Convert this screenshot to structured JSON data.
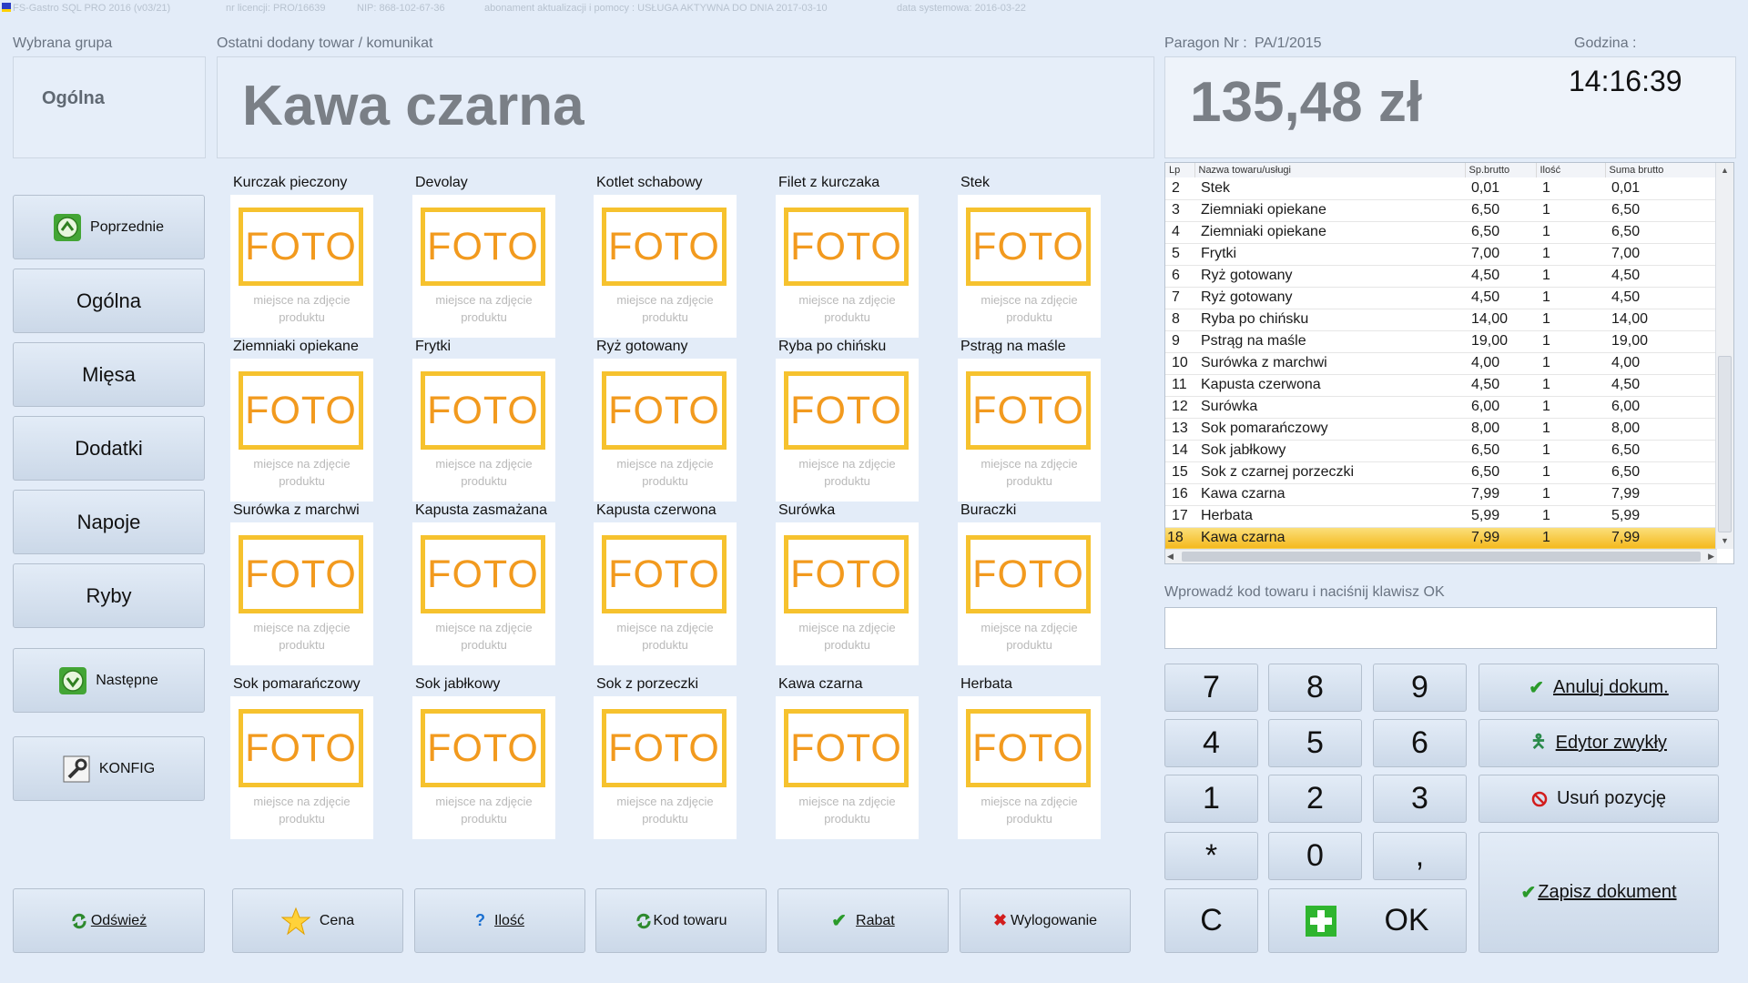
{
  "titlebar": {
    "app": "FS-Gastro SQL PRO 2016 (v03/21)",
    "license": "nr licencji: PRO/16639",
    "nip": "NIP: 868-102-67-36",
    "subscription": "abonament aktualizacji i pomocy : USŁUGA AKTYWNA DO DNIA 2017-03-10",
    "sysdate": "data systemowa: 2016-03-22"
  },
  "group": {
    "label": "Wybrana grupa",
    "value": "Ogólna"
  },
  "last": {
    "label": "Ostatni dodany towar / komunikat",
    "value": "Kawa czarna"
  },
  "receipt": {
    "label": "Paragon Nr :",
    "number": "PA/1/2015",
    "total": "135,48 zł",
    "time_label": "Godzina :",
    "time": "14:16:39"
  },
  "table": {
    "headers": [
      "Lp",
      "Nazwa towaru/usługi",
      "Sp.brutto",
      "Ilość",
      "Suma brutto"
    ],
    "rows": [
      [
        "2",
        "Stek",
        "0,01",
        "1",
        "0,01"
      ],
      [
        "3",
        "Ziemniaki opiekane",
        "6,50",
        "1",
        "6,50"
      ],
      [
        "4",
        "Ziemniaki opiekane",
        "6,50",
        "1",
        "6,50"
      ],
      [
        "5",
        "Frytki",
        "7,00",
        "1",
        "7,00"
      ],
      [
        "6",
        "Ryż gotowany",
        "4,50",
        "1",
        "4,50"
      ],
      [
        "7",
        "Ryż gotowany",
        "4,50",
        "1",
        "4,50"
      ],
      [
        "8",
        "Ryba po chińsku",
        "14,00",
        "1",
        "14,00"
      ],
      [
        "9",
        "Pstrąg na maśle",
        "19,00",
        "1",
        "19,00"
      ],
      [
        "10",
        "Surówka z marchwi",
        "4,00",
        "1",
        "4,00"
      ],
      [
        "11",
        "Kapusta czerwona",
        "4,50",
        "1",
        "4,50"
      ],
      [
        "12",
        "Surówka",
        "6,00",
        "1",
        "6,00"
      ],
      [
        "13",
        "Sok pomarańczowy",
        "8,00",
        "1",
        "8,00"
      ],
      [
        "14",
        "Sok jabłkowy",
        "6,50",
        "1",
        "6,50"
      ],
      [
        "15",
        "Sok z czarnej porzeczki",
        "6,50",
        "1",
        "6,50"
      ],
      [
        "16",
        "Kawa czarna",
        "7,99",
        "1",
        "7,99"
      ],
      [
        "17",
        "Herbata",
        "5,99",
        "1",
        "5,99"
      ],
      [
        "18",
        "Kawa czarna",
        "7,99",
        "1",
        "7,99"
      ]
    ],
    "selected_row": "18"
  },
  "code": {
    "label": "Wprowadź kod towaru i naciśnij klawisz OK",
    "value": ""
  },
  "nav": {
    "prev": "Poprzednie",
    "next": "Następne",
    "config": "KONFIG",
    "groups": [
      "Ogólna",
      "Mięsa",
      "Dodatki",
      "Napoje",
      "Ryby"
    ]
  },
  "products": [
    "Kurczak pieczony",
    "Devolay",
    "Kotlet schabowy",
    "Filet z kurczaka",
    "Stek",
    "Ziemniaki opiekane",
    "Frytki",
    "Ryż gotowany",
    "Ryba po chińsku",
    "Pstrąg na maśle",
    "Surówka z marchwi",
    "Kapusta zasmażana",
    "Kapusta czerwona",
    "Surówka",
    "Buraczki",
    "Sok pomarańczowy",
    "Sok jabłkowy",
    "Sok z porzeczki",
    "Kawa czarna",
    "Herbata"
  ],
  "placeholder": {
    "foto": "FOTO",
    "line1": "miejsce na zdjęcie",
    "line2": "produktu"
  },
  "numpad": {
    "keys": [
      "7",
      "8",
      "9",
      "4",
      "5",
      "6",
      "1",
      "2",
      "3",
      "*",
      "0",
      ",",
      "C"
    ],
    "ok": "OK"
  },
  "actions": {
    "cancel": "Anuluj dokum.",
    "editor": "Edytor zwykły",
    "remove": "Usuń pozycję",
    "save": "Zapisz dokument"
  },
  "footer": {
    "refresh": "Odśwież",
    "price": "Cena",
    "qty": "Ilość",
    "code": "Kod towaru",
    "discount": "Rabat",
    "logout": "Wylogowanie"
  },
  "colors": {
    "accent": "#f6c22e",
    "foto_text": "#f29a1e",
    "selected_row": "#f4b81c",
    "background": "#e3ecf8"
  }
}
